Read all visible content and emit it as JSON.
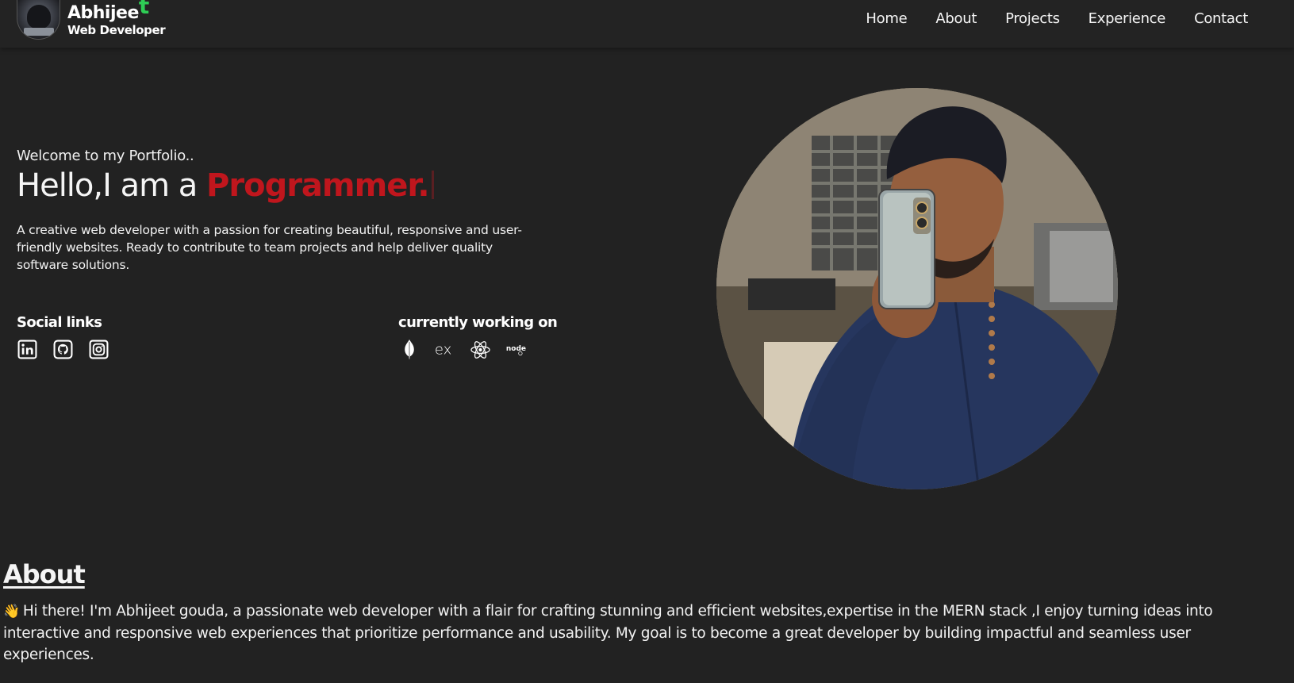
{
  "brand": {
    "name_main": "Abhijee",
    "name_accent": "t",
    "role": "Web Developer",
    "avatar_icon": "hacker-avatar-icon",
    "accent_color": "#2ecc55"
  },
  "nav": {
    "items": [
      {
        "label": "Home"
      },
      {
        "label": "About"
      },
      {
        "label": "Projects"
      },
      {
        "label": "Experience"
      },
      {
        "label": "Contact"
      }
    ]
  },
  "hero": {
    "welcome": "Welcome to my Portfolio..",
    "headline_prefix": "Hello,I am a",
    "headline_role": "Programmer.",
    "role_color": "#c0161d",
    "intro": "A creative web developer with a passion for creating beautiful, responsive and user-friendly websites. Ready to contribute to team projects and help deliver quality software solutions."
  },
  "social": {
    "title": "Social links",
    "icons": [
      "linkedin-icon",
      "github-icon",
      "instagram-icon"
    ]
  },
  "stack": {
    "title": "currently working on",
    "icons": [
      "mongodb-icon",
      "express-icon",
      "react-icon",
      "nodejs-icon"
    ]
  },
  "portrait": {
    "description_icon": "profile-photo"
  },
  "about": {
    "title": "About",
    "body": "Hi there! I'm Abhijeet gouda, a passionate web developer with a flair for crafting stunning and efficient websites,expertise in the MERN stack ,I enjoy turning ideas into interactive and responsive web experiences that prioritize performance and usability. My goal is to become a great developer by building impactful and seamless user experiences.",
    "wave_emoji": "👋"
  },
  "colors": {
    "background": "#222222",
    "navbar": "#232323",
    "text": "#f2f2f2"
  }
}
